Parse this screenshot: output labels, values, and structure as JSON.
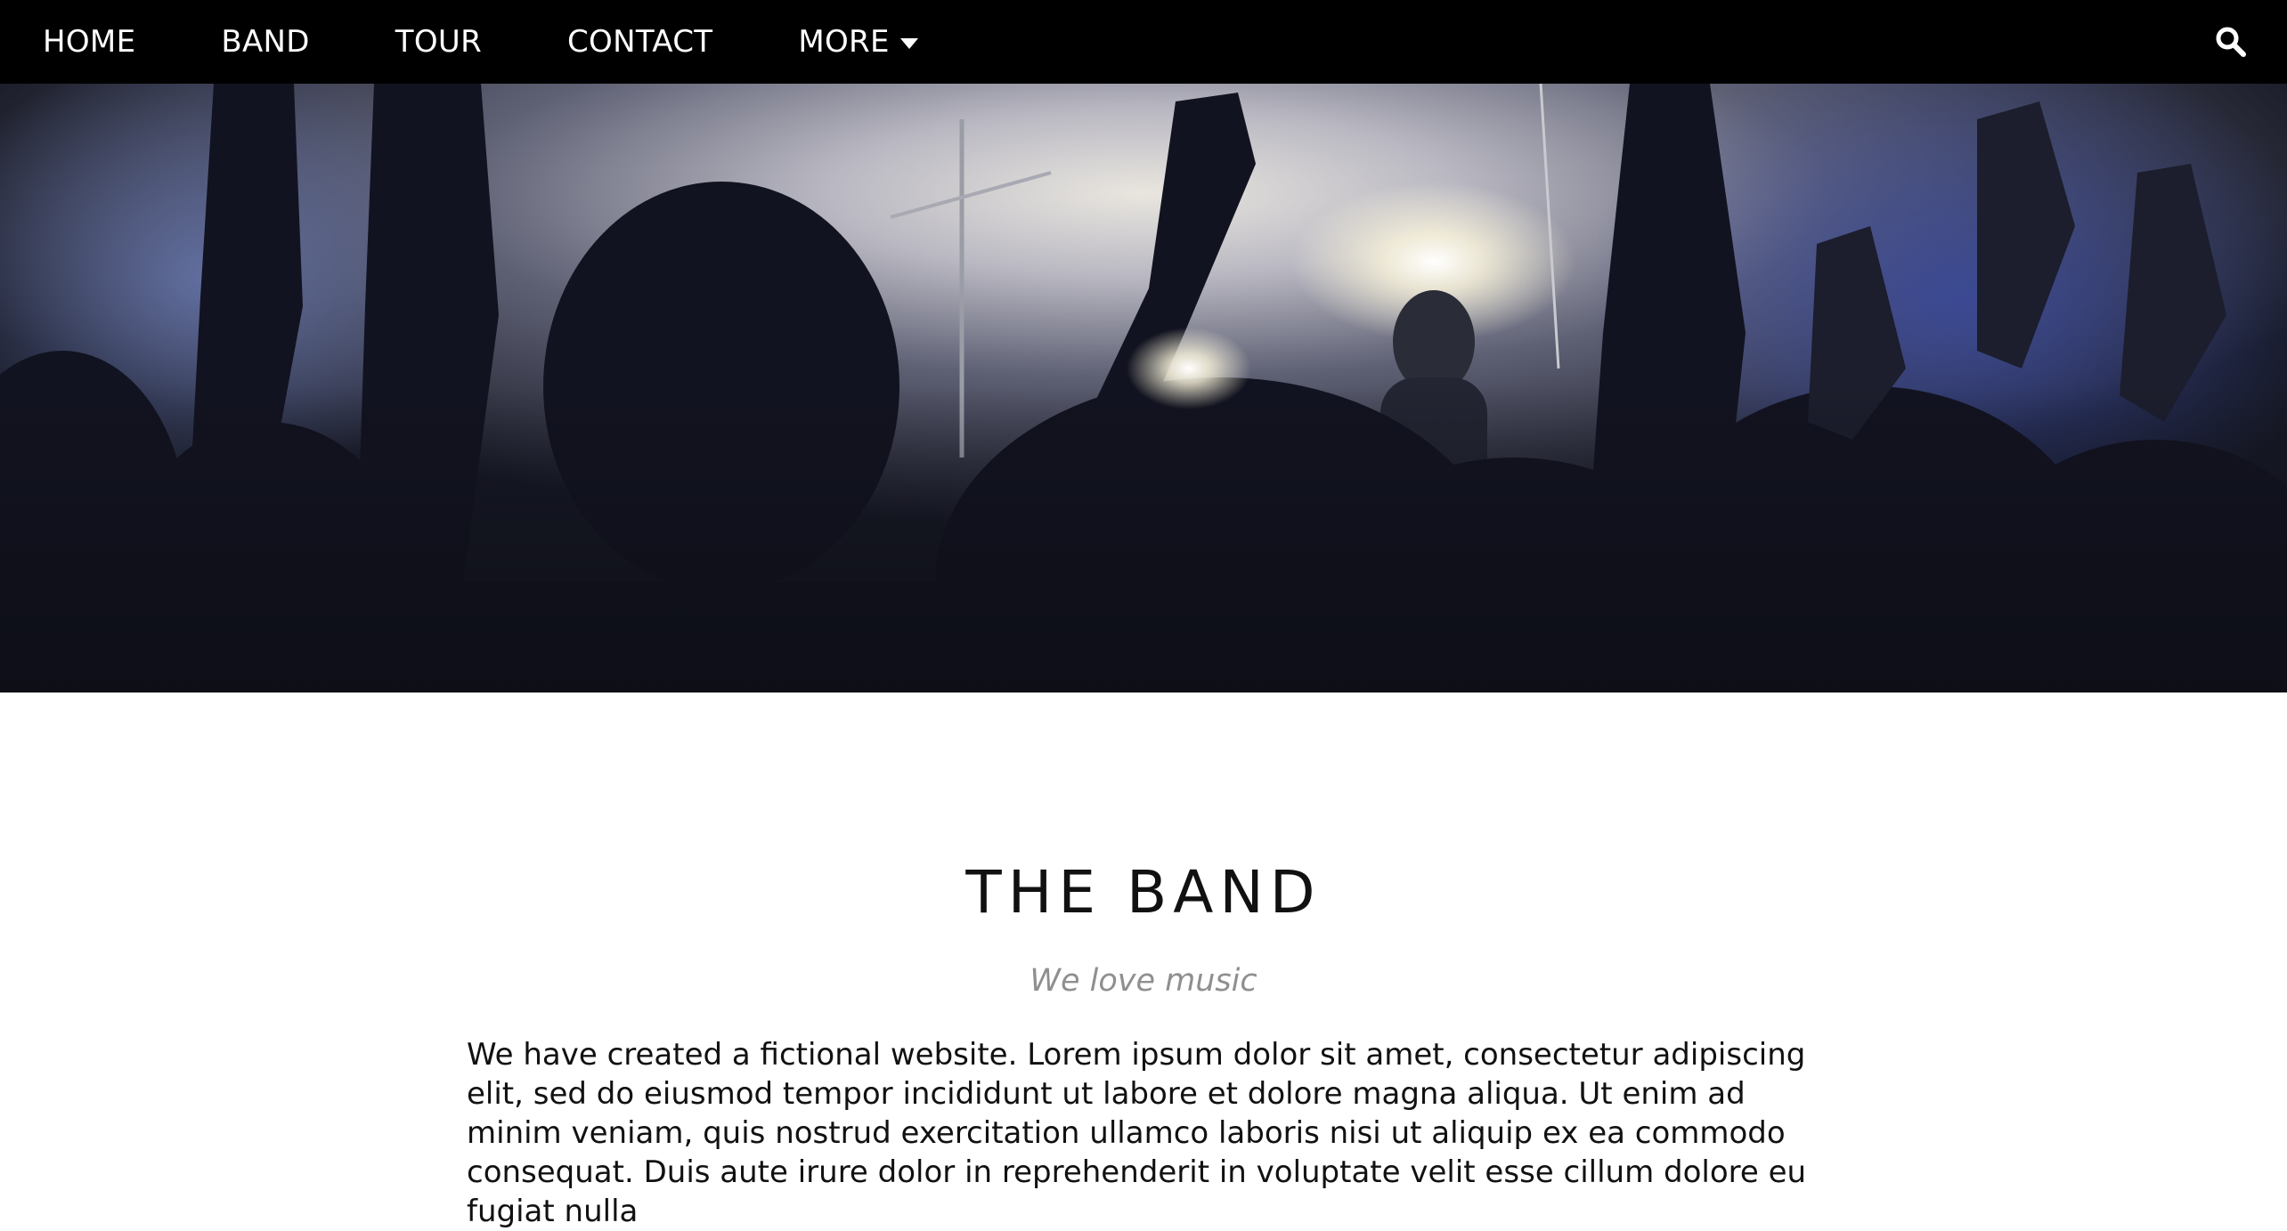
{
  "nav": {
    "items": [
      {
        "label": "HOME"
      },
      {
        "label": "BAND"
      },
      {
        "label": "TOUR"
      },
      {
        "label": "CONTACT"
      },
      {
        "label": "MORE"
      }
    ],
    "more_icon": "caret-down-icon",
    "search_icon": "search-icon"
  },
  "hero": {
    "image": "concert-crowd-photo"
  },
  "section": {
    "title": "THE BAND",
    "subtitle": "We love music",
    "paragraph": "We have created a fictional website. Lorem ipsum dolor sit amet, consectetur adipiscing elit, sed do eiusmod tempor incididunt ut labore et dolore magna aliqua. Ut enim ad minim veniam, quis nostrud exercitation ullamco laboris nisi ut aliquip ex ea commodo consequat. Duis aute irure dolor in reprehenderit in voluptate velit esse cillum dolore eu fugiat nulla"
  },
  "colors": {
    "nav_bg": "#000000",
    "nav_text": "#ffffff",
    "subtitle": "#8f8f8f"
  }
}
